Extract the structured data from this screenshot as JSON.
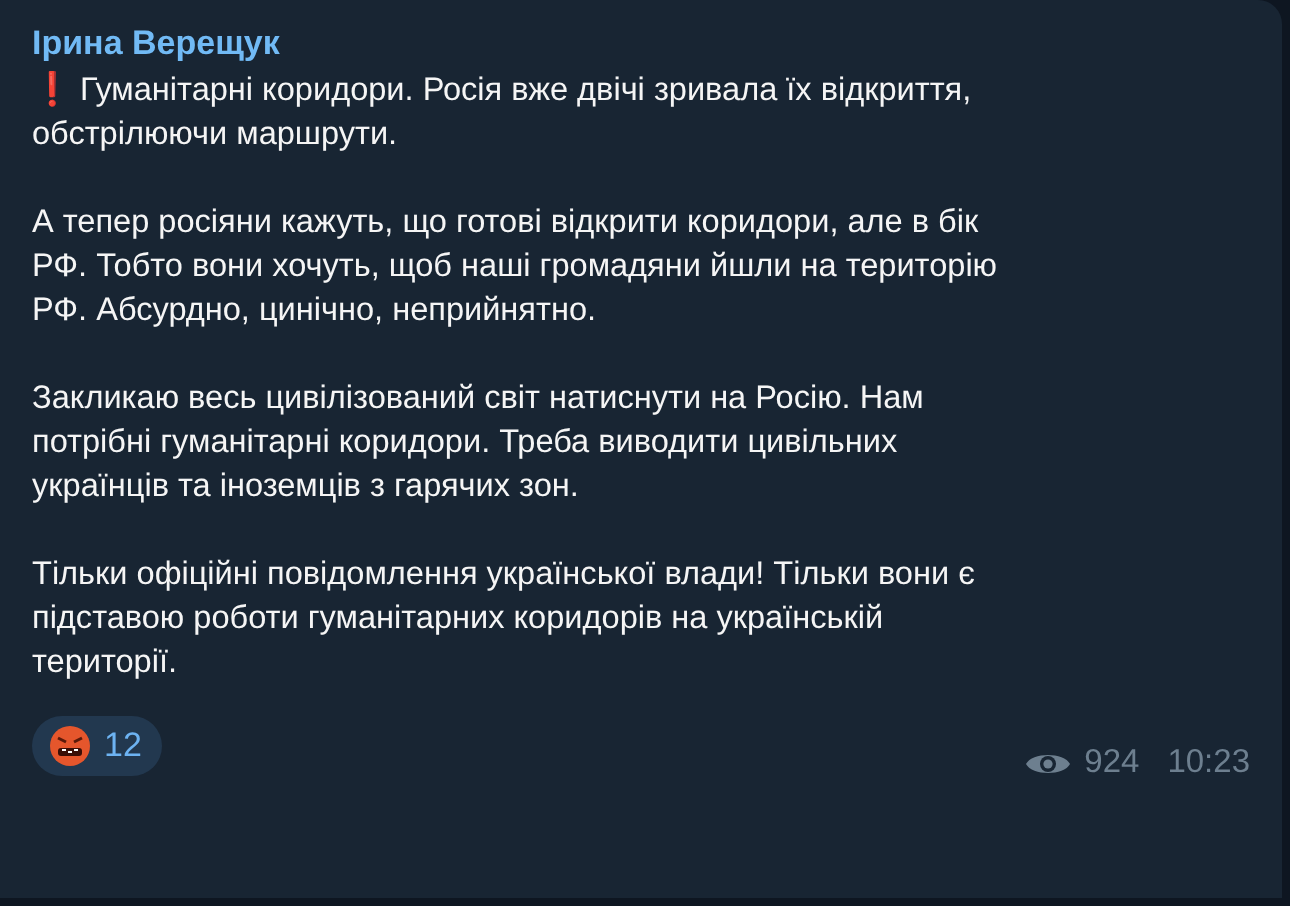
{
  "message": {
    "author": "Ірина Верещук",
    "paragraphs": [
      {
        "mark": "❗",
        "lines": [
          "Гуманітарні коридори. Росія вже двічі зривала їх відкриття,",
          "обстрілюючи маршрути."
        ]
      },
      {
        "lines": [
          "А тепер росіяни кажуть, що готові відкрити коридори, але в бік",
          "РФ. Тобто вони хочуть, щоб наші громадяни йшли на територію",
          "РФ. Абсурдно, цинічно, неприйнятно."
        ]
      },
      {
        "lines": [
          "Закликаю весь цивілізований світ натиснути на Росію. Нам",
          "потрібні гуманітарні коридори. Треба виводити цивільних",
          "українців та іноземців з гарячих зон."
        ]
      },
      {
        "lines": [
          "Тільки офіційні повідомлення української влади! Тільки вони є",
          "підставою роботи гуманітарних коридорів на українській",
          "території."
        ]
      }
    ],
    "reaction": {
      "count": "12"
    },
    "views": "924",
    "time": "10:23"
  }
}
